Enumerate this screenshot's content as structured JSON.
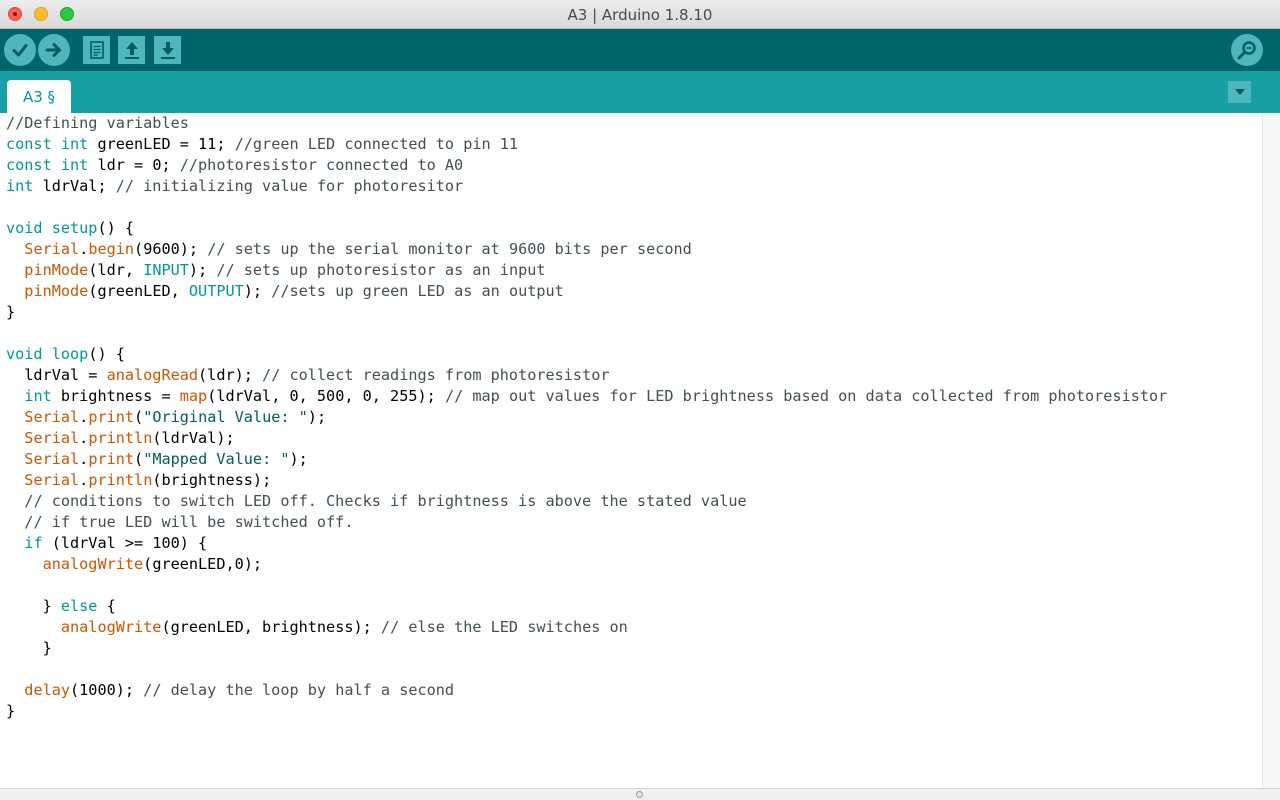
{
  "window": {
    "title": "A3 | Arduino 1.8.10"
  },
  "toolbar": {
    "verify_icon": "checkmark-icon",
    "upload_icon": "arrow-right-icon",
    "new_icon": "new-file-icon",
    "open_icon": "open-upload-icon",
    "save_icon": "save-download-icon",
    "serial_monitor_icon": "magnifier-icon"
  },
  "tabs": [
    {
      "label": "A3 §"
    }
  ],
  "colors": {
    "toolbar_bg": "#006468",
    "tabbar_bg": "#17a1a5",
    "button_bg": "#4db7bb",
    "keyword": "#00979c",
    "function": "#d35400",
    "comment": "#434f54",
    "string": "#005c5f"
  },
  "code": [
    [
      [
        "com",
        "//Defining variables"
      ]
    ],
    [
      [
        "kw",
        "const"
      ],
      [
        "",
        " "
      ],
      [
        "kw",
        "int"
      ],
      [
        "",
        " greenLED = 11; "
      ],
      [
        "com",
        "//green LED connected to pin 11"
      ]
    ],
    [
      [
        "kw",
        "const"
      ],
      [
        "",
        " "
      ],
      [
        "kw",
        "int"
      ],
      [
        "",
        " ldr = 0; "
      ],
      [
        "com",
        "//photoresistor connected to A0"
      ]
    ],
    [
      [
        "kw",
        "int"
      ],
      [
        "",
        " ldrVal; "
      ],
      [
        "com",
        "// initializing value for photoresitor"
      ]
    ],
    [
      [
        "",
        ""
      ]
    ],
    [
      [
        "kw",
        "void"
      ],
      [
        "",
        " "
      ],
      [
        "kw",
        "setup"
      ],
      [
        "",
        "() {"
      ]
    ],
    [
      [
        "",
        "  "
      ],
      [
        "fn",
        "Serial"
      ],
      [
        "",
        "."
      ],
      [
        "fn",
        "begin"
      ],
      [
        "",
        "(9600); "
      ],
      [
        "com",
        "// sets up the serial monitor at 9600 bits per second"
      ]
    ],
    [
      [
        "",
        "  "
      ],
      [
        "fn",
        "pinMode"
      ],
      [
        "",
        "(ldr, "
      ],
      [
        "cst",
        "INPUT"
      ],
      [
        "",
        "); "
      ],
      [
        "com",
        "// sets up photoresistor as an input"
      ]
    ],
    [
      [
        "",
        "  "
      ],
      [
        "fn",
        "pinMode"
      ],
      [
        "",
        "(greenLED, "
      ],
      [
        "cst",
        "OUTPUT"
      ],
      [
        "",
        "); "
      ],
      [
        "com",
        "//sets up green LED as an output"
      ]
    ],
    [
      [
        "",
        "}"
      ]
    ],
    [
      [
        "",
        ""
      ]
    ],
    [
      [
        "kw",
        "void"
      ],
      [
        "",
        " "
      ],
      [
        "kw",
        "loop"
      ],
      [
        "",
        "() {"
      ]
    ],
    [
      [
        "",
        "  ldrVal = "
      ],
      [
        "fn",
        "analogRead"
      ],
      [
        "",
        "(ldr); "
      ],
      [
        "com",
        "// collect readings from photoresistor"
      ]
    ],
    [
      [
        "",
        "  "
      ],
      [
        "kw",
        "int"
      ],
      [
        "",
        " brightness = "
      ],
      [
        "fn",
        "map"
      ],
      [
        "",
        "(ldrVal, 0, 500, 0, 255); "
      ],
      [
        "com",
        "// map out values for LED brightness based on data collected from photoresistor"
      ]
    ],
    [
      [
        "",
        "  "
      ],
      [
        "fn",
        "Serial"
      ],
      [
        "",
        "."
      ],
      [
        "fn",
        "print"
      ],
      [
        "",
        "("
      ],
      [
        "str",
        "\"Original Value: \""
      ],
      [
        "",
        ");"
      ]
    ],
    [
      [
        "",
        "  "
      ],
      [
        "fn",
        "Serial"
      ],
      [
        "",
        "."
      ],
      [
        "fn",
        "println"
      ],
      [
        "",
        "(ldrVal);"
      ]
    ],
    [
      [
        "",
        "  "
      ],
      [
        "fn",
        "Serial"
      ],
      [
        "",
        "."
      ],
      [
        "fn",
        "print"
      ],
      [
        "",
        "("
      ],
      [
        "str",
        "\"Mapped Value: \""
      ],
      [
        "",
        ");"
      ]
    ],
    [
      [
        "",
        "  "
      ],
      [
        "fn",
        "Serial"
      ],
      [
        "",
        "."
      ],
      [
        "fn",
        "println"
      ],
      [
        "",
        "(brightness);"
      ]
    ],
    [
      [
        "",
        "  "
      ],
      [
        "com",
        "// conditions to switch LED off. Checks if brightness is above the stated value"
      ]
    ],
    [
      [
        "",
        "  "
      ],
      [
        "com",
        "// if true LED will be switched off."
      ]
    ],
    [
      [
        "",
        "  "
      ],
      [
        "kw",
        "if"
      ],
      [
        "",
        " (ldrVal >= 100) {"
      ]
    ],
    [
      [
        "",
        "    "
      ],
      [
        "fn",
        "analogWrite"
      ],
      [
        "",
        "(greenLED,0);"
      ]
    ],
    [
      [
        "",
        ""
      ]
    ],
    [
      [
        "",
        "    } "
      ],
      [
        "kw",
        "else"
      ],
      [
        "",
        " {"
      ]
    ],
    [
      [
        "",
        "      "
      ],
      [
        "fn",
        "analogWrite"
      ],
      [
        "",
        "(greenLED, brightness); "
      ],
      [
        "com",
        "// else the LED switches on"
      ]
    ],
    [
      [
        "",
        "    }"
      ]
    ],
    [
      [
        "",
        ""
      ]
    ],
    [
      [
        "",
        "  "
      ],
      [
        "fn",
        "delay"
      ],
      [
        "",
        "(1000); "
      ],
      [
        "com",
        "// delay the loop by half a second"
      ]
    ],
    [
      [
        "",
        "}"
      ]
    ]
  ]
}
